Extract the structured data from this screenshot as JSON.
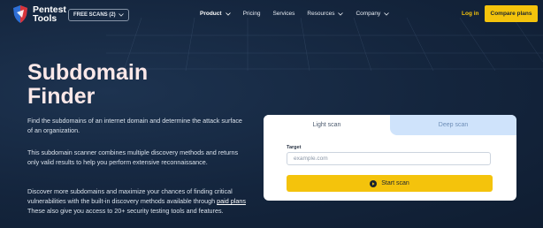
{
  "brand": {
    "name_line1": "Pentest",
    "name_line2": "Tools"
  },
  "header": {
    "free_scans_label": "FREE SCANS (2)",
    "nav": [
      {
        "label": "Product",
        "has_dropdown": true,
        "active": true
      },
      {
        "label": "Pricing",
        "has_dropdown": false,
        "active": false
      },
      {
        "label": "Services",
        "has_dropdown": false,
        "active": false
      },
      {
        "label": "Resources",
        "has_dropdown": true,
        "active": false
      },
      {
        "label": "Company",
        "has_dropdown": true,
        "active": false
      }
    ],
    "login_label": "Log in",
    "compare_label": "Compare plans"
  },
  "hero": {
    "title_line1": "Subdomain",
    "title_line2": "Finder",
    "para1": "Find the subdomains of an internet domain and determine the attack surface of an organization.",
    "para2": "This subdomain scanner combines multiple discovery methods and returns only valid results to help you perform extensive reconnaissance.",
    "para3_before": "Discover more subdomains and maximize your chances of finding critical vulnerabilities with the built-in discovery methods available through ",
    "para3_link": "paid plans",
    "para3_after": " These also give you access to 20+ security testing tools and features."
  },
  "scan": {
    "tab_light": "Light scan",
    "tab_deep": "Deep scan",
    "target_label": "Target",
    "target_placeholder": "example.com",
    "start_label": "Start scan"
  },
  "colors": {
    "accent": "#f4c30c",
    "background": "#13233a",
    "deep_tab": "#cfe3fb"
  },
  "icons": {
    "logo": "shield-logo-icon",
    "dropdown": "chevron-down-icon",
    "start": "play-circle-icon"
  }
}
